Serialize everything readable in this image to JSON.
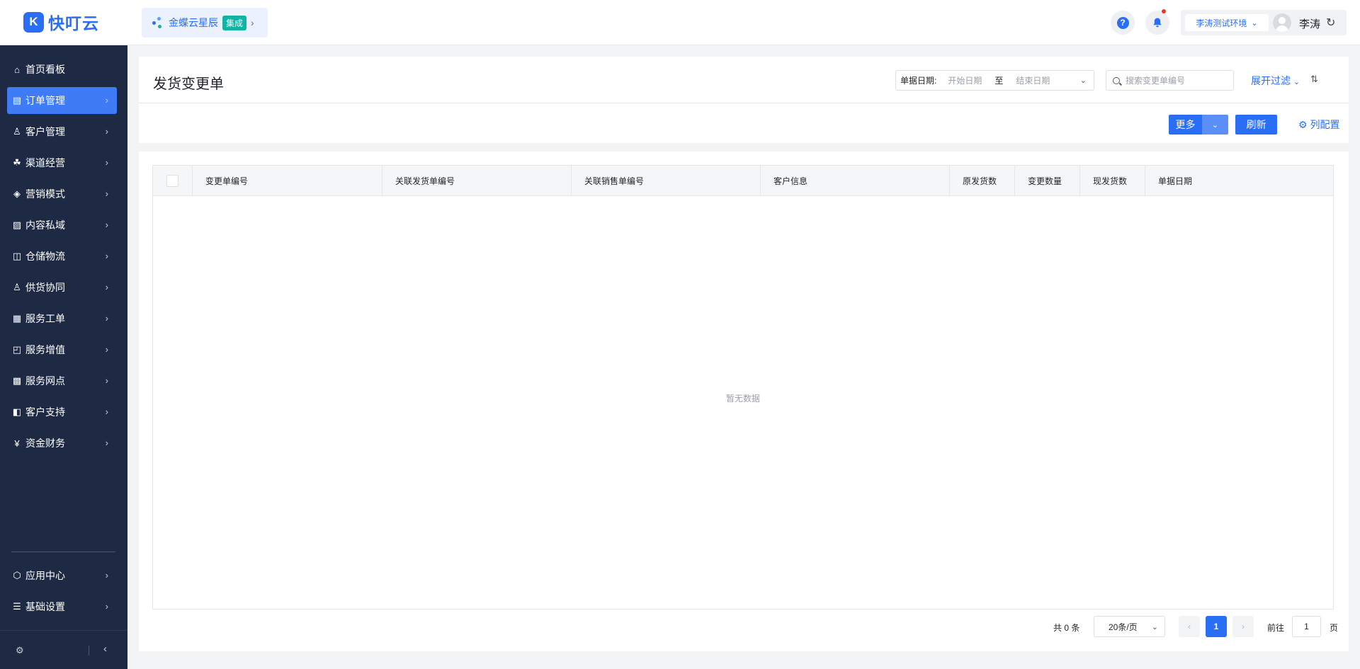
{
  "brand": {
    "mark": "K",
    "name": "快叮云"
  },
  "integration": {
    "name": "金蝶云星辰",
    "badge": "集成"
  },
  "header": {
    "environment": "李涛测试环境",
    "user_name": "李涛"
  },
  "sidebar": {
    "items": [
      {
        "label": "首页看板",
        "icon": "home-icon",
        "glyph": "⌂",
        "has_arrow": false
      },
      {
        "label": "订单管理",
        "icon": "order-icon",
        "glyph": "▤",
        "has_arrow": true,
        "active": true
      },
      {
        "label": "客户管理",
        "icon": "customer-icon",
        "glyph": "♙",
        "has_arrow": true
      },
      {
        "label": "渠道经营",
        "icon": "channel-icon",
        "glyph": "☘",
        "has_arrow": true
      },
      {
        "label": "营销模式",
        "icon": "tag-icon",
        "glyph": "◈",
        "has_arrow": true
      },
      {
        "label": "内容私域",
        "icon": "image-icon",
        "glyph": "▨",
        "has_arrow": true
      },
      {
        "label": "仓储物流",
        "icon": "warehouse-icon",
        "glyph": "◫",
        "has_arrow": true
      },
      {
        "label": "供货协同",
        "icon": "supply-icon",
        "glyph": "♙",
        "has_arrow": true
      },
      {
        "label": "服务工单",
        "icon": "ticket-icon",
        "glyph": "▦",
        "has_arrow": true
      },
      {
        "label": "服务增值",
        "icon": "bag-icon",
        "glyph": "◰",
        "has_arrow": true
      },
      {
        "label": "服务网点",
        "icon": "store-icon",
        "glyph": "▩",
        "has_arrow": true
      },
      {
        "label": "客户支持",
        "icon": "support-icon",
        "glyph": "◧",
        "has_arrow": true
      },
      {
        "label": "资金财务",
        "icon": "finance-icon",
        "glyph": "¥",
        "has_arrow": true
      }
    ],
    "bottom_items": [
      {
        "label": "应用中心",
        "icon": "cube-icon",
        "glyph": "⬡",
        "has_arrow": true
      },
      {
        "label": "基础设置",
        "icon": "settings-list-icon",
        "glyph": "☰",
        "has_arrow": true
      }
    ]
  },
  "page": {
    "title": "发货变更单",
    "date_filter": {
      "label": "单据日期:",
      "start_placeholder": "开始日期",
      "separator": "至",
      "end_placeholder": "结束日期"
    },
    "search_placeholder": "搜索变更单编号",
    "expand_filter": "展开过滤",
    "buttons": {
      "more": "更多",
      "refresh": "刷新",
      "column_config": "列配置"
    }
  },
  "table": {
    "columns": [
      "变更单编号",
      "关联发货单编号",
      "关联销售单编号",
      "客户信息",
      "原发货数",
      "变更数量",
      "现发货数",
      "单据日期"
    ],
    "rows": [],
    "empty_text": "暂无数据"
  },
  "pagination": {
    "total": "共 0 条",
    "page_size": "20条/页",
    "current_page": "1",
    "goto_label": "前往",
    "goto_value": "1",
    "page_suffix": "页"
  },
  "colors": {
    "accent": "#2a6ef5",
    "sidebar_bg": "#1e2a44",
    "badge": "#12b2a4"
  }
}
